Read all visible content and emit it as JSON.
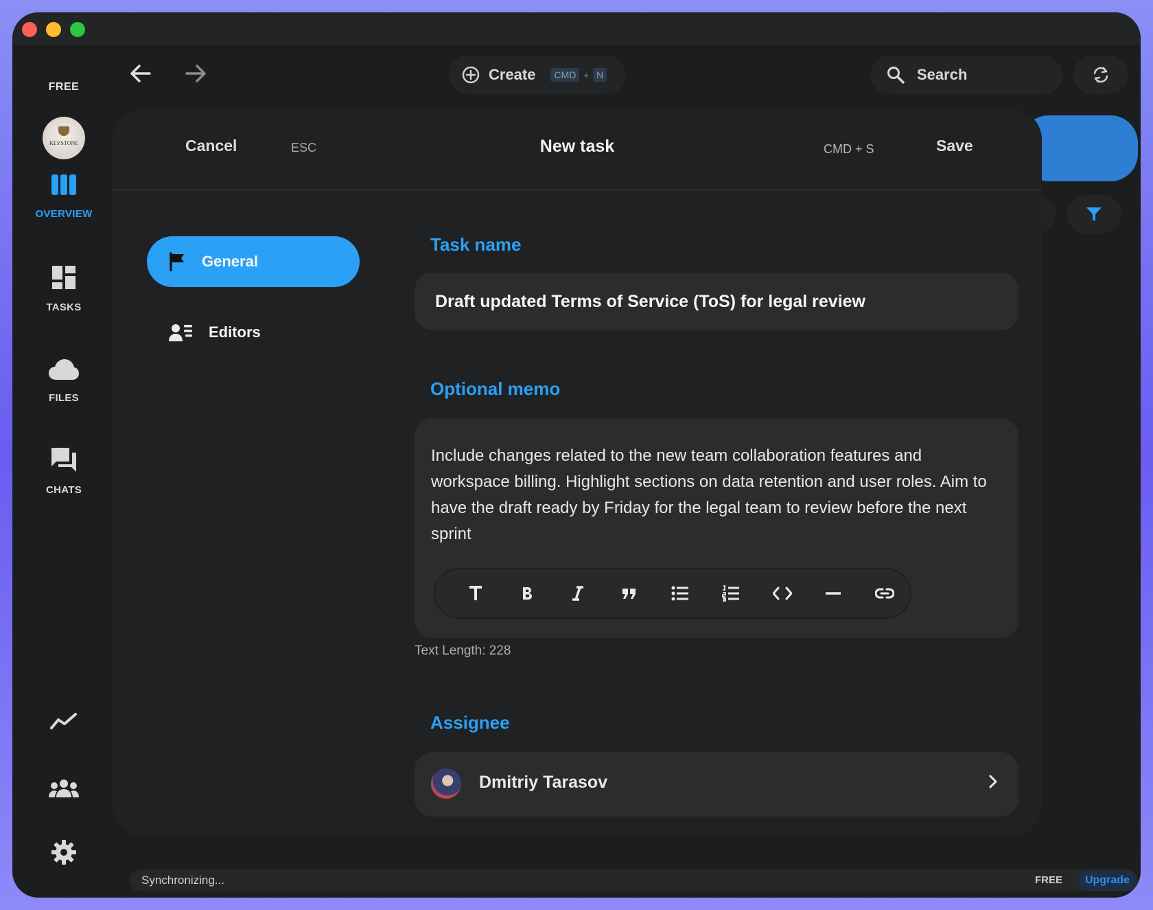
{
  "sidebar": {
    "plan": "FREE",
    "org_avatar_text": "KEYSTONE",
    "items": [
      {
        "label": "OVERVIEW",
        "active": true
      },
      {
        "label": "TASKS"
      },
      {
        "label": "FILES"
      },
      {
        "label": "CHATS"
      }
    ]
  },
  "toolbar": {
    "create_label": "Create",
    "create_shortcut_key1": "CMD",
    "create_shortcut_plus": "+",
    "create_shortcut_key2": "N",
    "search_label": "Search"
  },
  "modal": {
    "cancel_label": "Cancel",
    "cancel_shortcut": "ESC",
    "title": "New task",
    "save_shortcut": "CMD + S",
    "save_label": "Save",
    "tabs": [
      {
        "label": "General",
        "active": true
      },
      {
        "label": "Editors"
      }
    ],
    "task_name_label": "Task name",
    "task_name_value": "Draft updated Terms of Service (ToS) for legal review",
    "memo_label": "Optional memo",
    "memo_value": "Include changes related to the new team collaboration features and workspace billing. Highlight sections on data retention and user roles. Aim to have the draft ready by Friday for the legal team to review before the next sprint",
    "text_length": "Text Length: 228",
    "assignee_label": "Assignee",
    "assignee_name": "Dmitriy Tarasov"
  },
  "statusbar": {
    "status": "Synchronizing...",
    "plan": "FREE",
    "upgrade_label": "Upgrade"
  },
  "colors": {
    "accent": "#2aa1f5",
    "background": "#1c1d1f",
    "modal": "#202123",
    "field": "#2b2c2e"
  }
}
